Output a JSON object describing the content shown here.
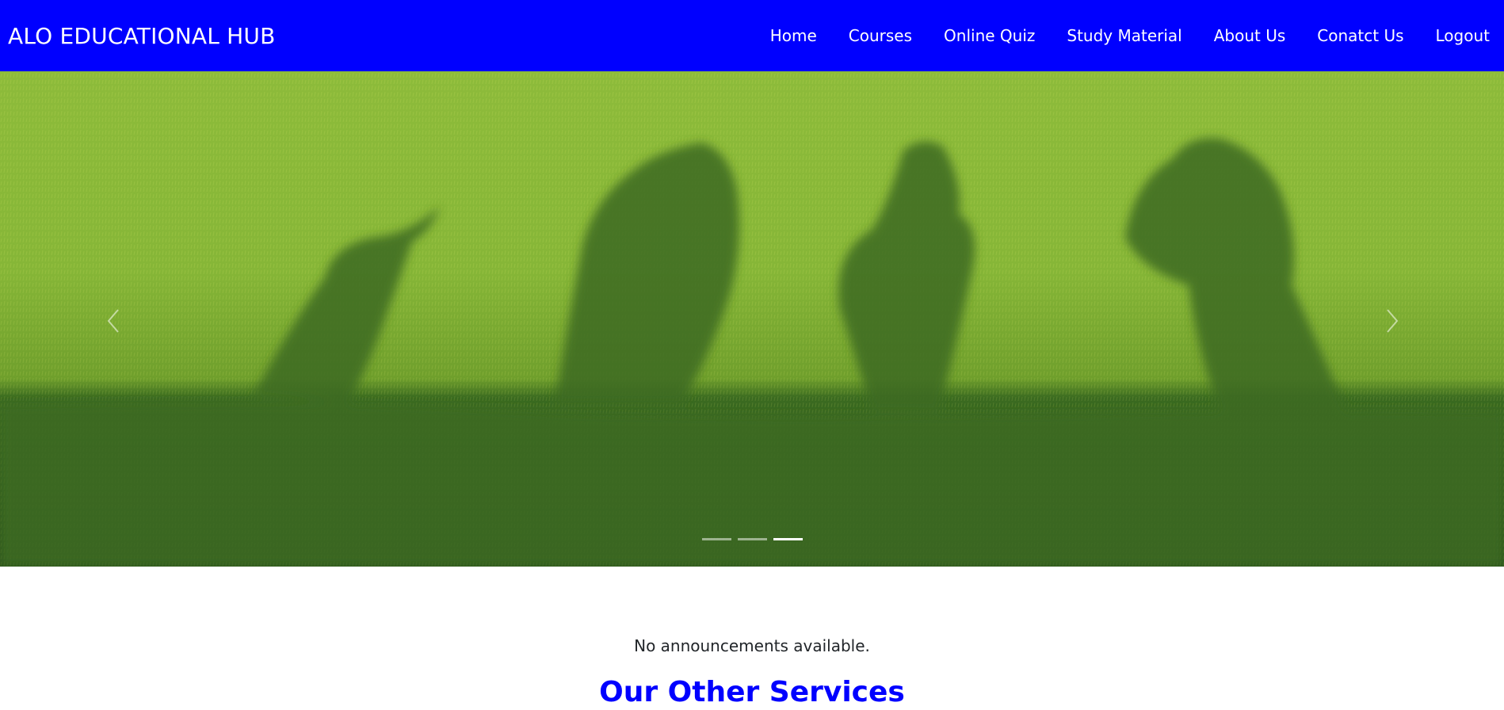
{
  "brand": "ALO EDUCATIONAL HUB",
  "nav": {
    "items": [
      {
        "label": "Home"
      },
      {
        "label": "Courses"
      },
      {
        "label": "Online Quiz"
      },
      {
        "label": "Study Material"
      },
      {
        "label": "About Us"
      },
      {
        "label": "Conatct Us"
      },
      {
        "label": "Logout"
      }
    ]
  },
  "carousel": {
    "prev_icon": "chevron-left-icon",
    "next_icon": "chevron-right-icon",
    "slide_count": 3,
    "active_slide": 3
  },
  "announcement": "No announcements available.",
  "services_title": "Our Other Services",
  "colors": {
    "navbar_bg": "#0000ff",
    "heading": "#0000ff",
    "text": "#212529"
  }
}
